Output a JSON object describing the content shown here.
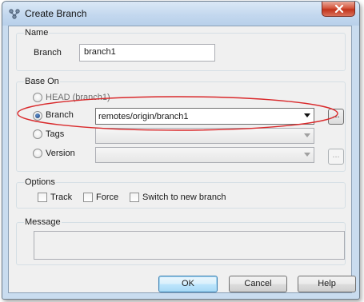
{
  "window": {
    "title": "Create Branch",
    "icon": "git-branch-icon"
  },
  "name_group": {
    "title": "Name",
    "branch_label": "Branch",
    "branch_value": "branch1"
  },
  "base_on_group": {
    "title": "Base On",
    "head_option": "HEAD (branch1)",
    "branch_option": "Branch",
    "branch_value": "remotes/origin/branch1",
    "tags_option": "Tags",
    "tags_value": "",
    "version_option": "Version",
    "version_value": "",
    "selected": "Branch",
    "browse_label": "..."
  },
  "options_group": {
    "title": "Options",
    "track_label": "Track",
    "force_label": "Force",
    "switch_label": "Switch to new branch"
  },
  "message_group": {
    "title": "Message",
    "value": ""
  },
  "buttons": {
    "ok": "OK",
    "cancel": "Cancel",
    "help": "Help"
  },
  "colors": {
    "annotation": "#d9292b",
    "titlebar": "#c2d7ee",
    "close": "#c2341c"
  }
}
